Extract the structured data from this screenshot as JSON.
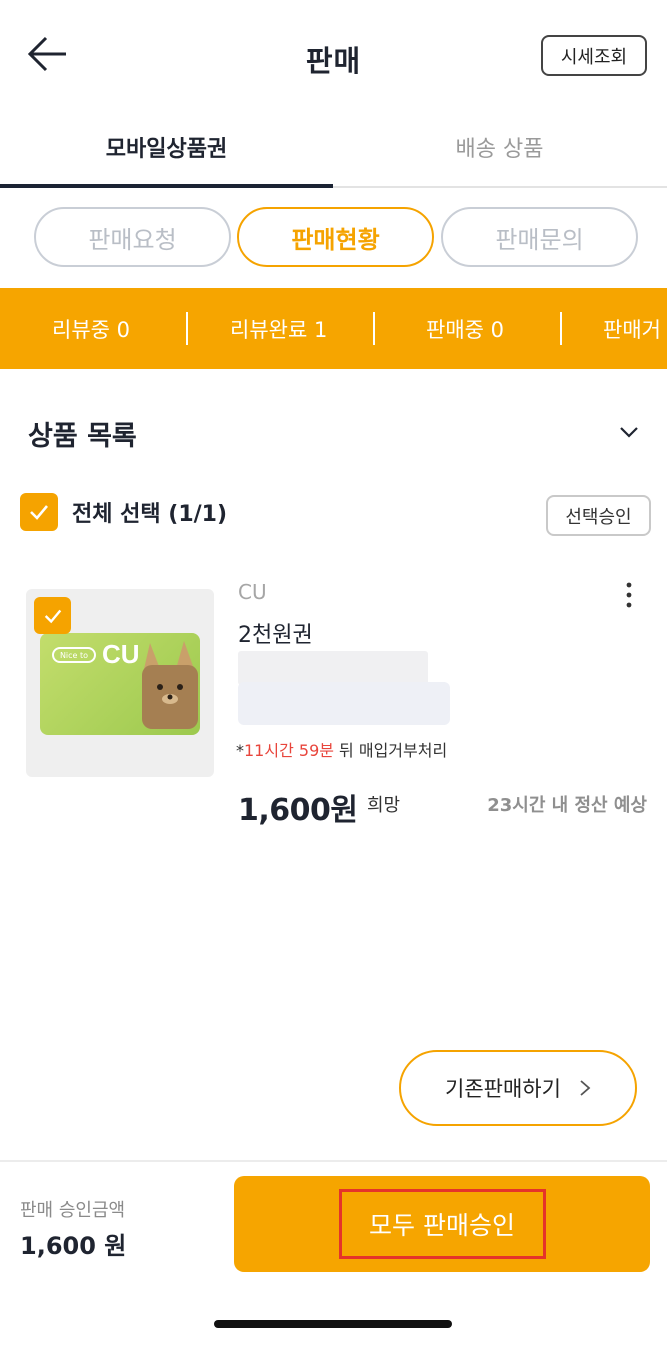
{
  "header": {
    "title": "판매",
    "price_check_label": "시세조회"
  },
  "main_tabs": [
    {
      "label": "모바일상품권",
      "active": true
    },
    {
      "label": "배송 상품",
      "active": false
    }
  ],
  "segments": [
    {
      "label": "판매요청",
      "active": false
    },
    {
      "label": "판매현황",
      "active": true
    },
    {
      "label": "판매문의",
      "active": false
    }
  ],
  "status_bar": {
    "items": [
      "리뷰중 0",
      "리뷰완료 1",
      "판매중 0",
      "판매거"
    ],
    "color": "#F6A500"
  },
  "section": {
    "title": "상품 목록",
    "select_all_label": "전체 선택 (1/1)",
    "approve_selected_label": "선택승인"
  },
  "product": {
    "brand": "CU",
    "name": "2천원권",
    "card_pill": "Nice to",
    "card_logo": "CU",
    "deadline_prefix": "*",
    "deadline_time": "11시간 59분",
    "deadline_suffix": " 뒤 매입거부처리",
    "price": "1,600원",
    "price_suffix": "희망",
    "settle_note": "23시간 내 정산 예상"
  },
  "existing_sale_label": "기존판매하기",
  "footer": {
    "amount_label": "판매 승인금액",
    "amount_value": "1,600 원",
    "approve_all_label": "모두 판매승인"
  },
  "colors": {
    "accent": "#F6A500",
    "highlight_border": "#E5332A",
    "deadline_red": "#E8453C"
  },
  "icons": [
    "back-arrow-icon",
    "chevron-down-icon",
    "check-icon",
    "more-vertical-icon",
    "chevron-right-icon"
  ]
}
